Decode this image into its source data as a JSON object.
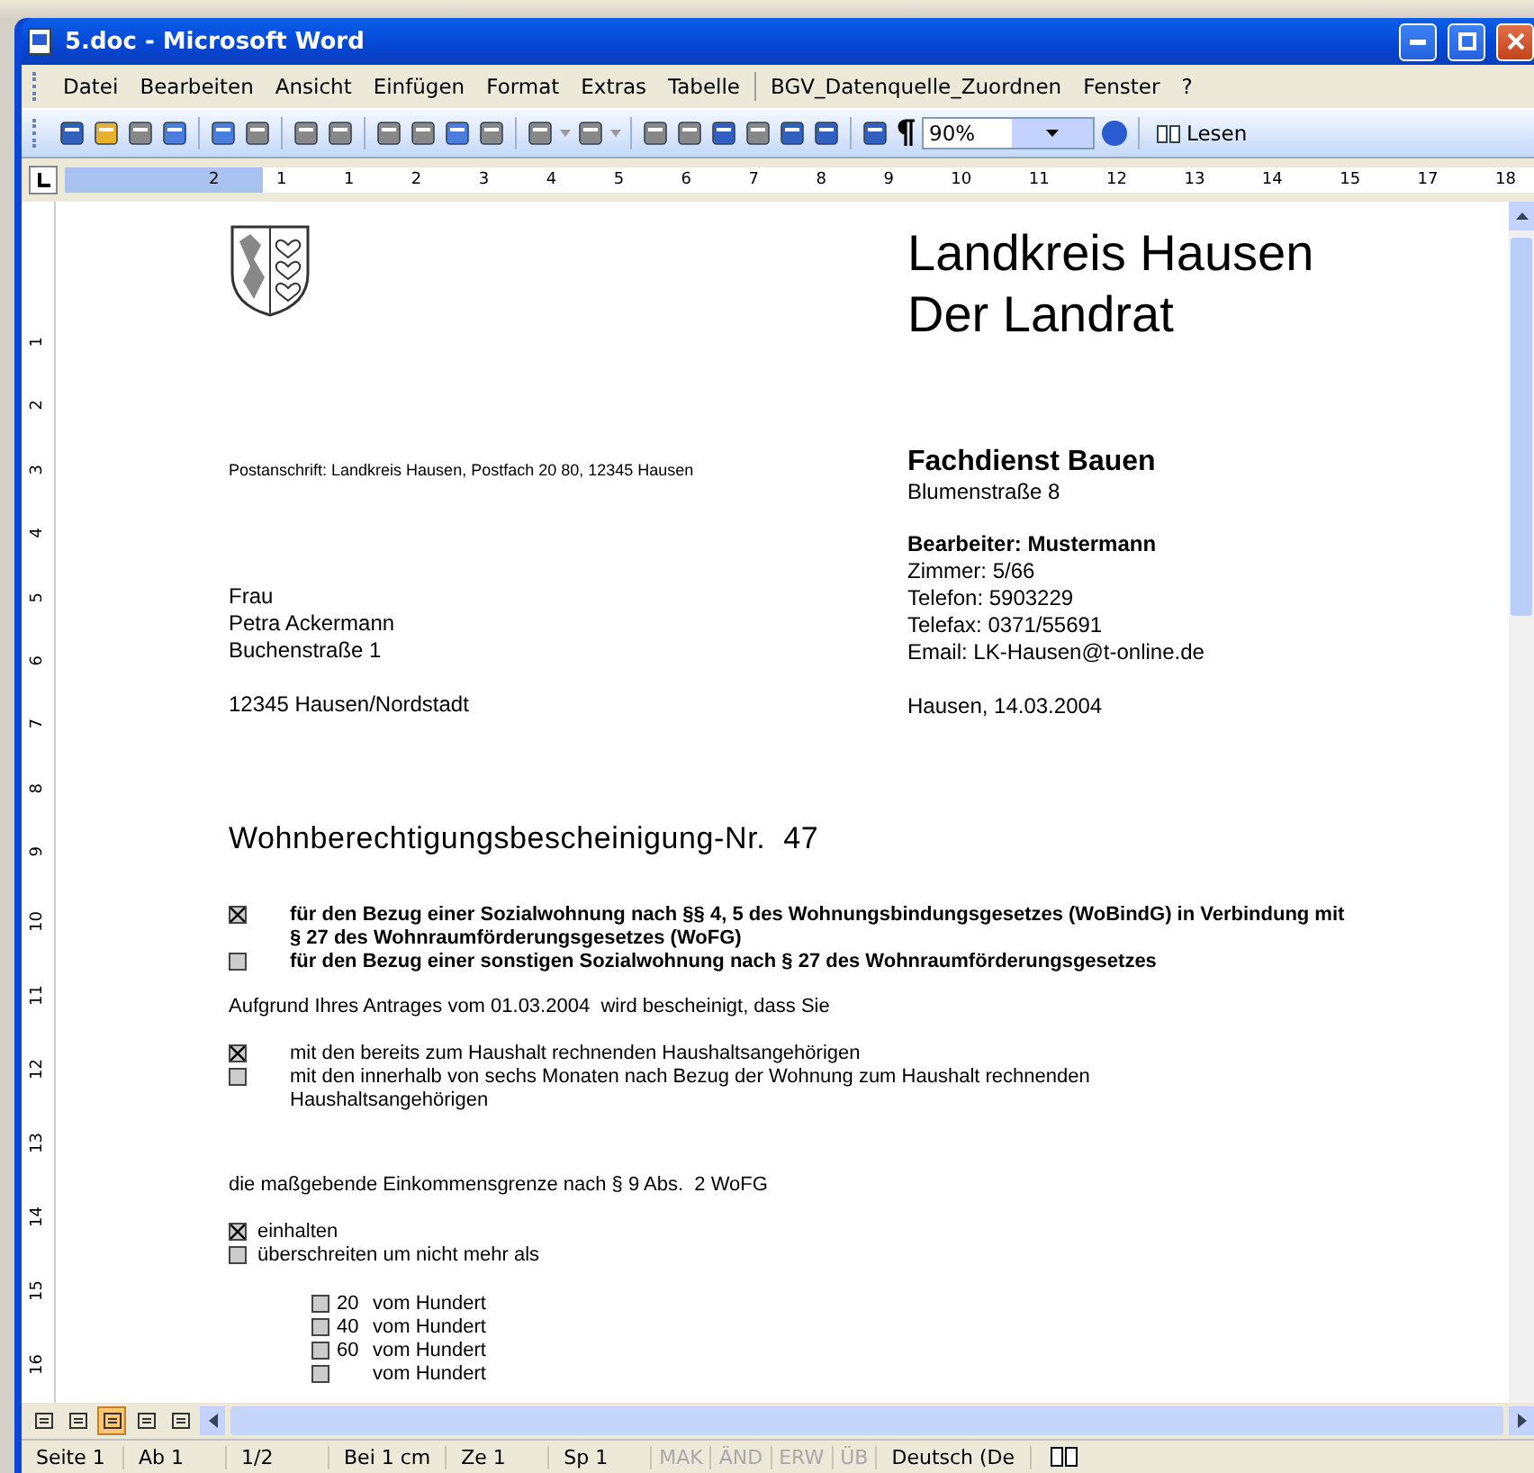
{
  "window": {
    "title": "5.doc - Microsoft Word"
  },
  "menu": [
    "Datei",
    "Bearbeiten",
    "Ansicht",
    "Einfügen",
    "Format",
    "Extras",
    "Tabelle",
    "BGV_Datenquelle_Zuordnen",
    "Fenster",
    "?"
  ],
  "toolbar": {
    "zoom": "90%",
    "read_button": "Lesen"
  },
  "ruler": {
    "marks": [
      "2",
      "1",
      "1",
      "2",
      "3",
      "4",
      "5",
      "6",
      "7",
      "8",
      "9",
      "10",
      "11",
      "12",
      "13",
      "14",
      "15",
      "17",
      "18"
    ]
  },
  "vertical_ruler": {
    "marks": [
      "1",
      "2",
      "3",
      "4",
      "5",
      "6",
      "7",
      "8",
      "9",
      "10",
      "11",
      "12",
      "13",
      "14",
      "15",
      "16"
    ]
  },
  "letter": {
    "org_lines": [
      "Landkreis Hausen",
      "Der Landrat"
    ],
    "return_address": "Postanschrift: Landkreis Hausen, Postfach 20 80, 12345 Hausen",
    "recipient": [
      "Frau",
      "Petra Ackermann",
      "Buchenstraße 1"
    ],
    "recipient_city": "12345 Hausen/Nordstadt",
    "department": "Fachdienst Bauen",
    "department_address": "Blumenstraße 8",
    "clerk": "Bearbeiter: Mustermann",
    "contact": [
      "Zimmer: 5/66",
      "Telefon: 5903229",
      "Telefax: 0371/55691",
      "Email: LK-Hausen@t-online.de"
    ],
    "date": "Hausen, 14.03.2004",
    "certificate_title": "Wohnberechtigungsbescheinigung-Nr.  47",
    "purpose_options": [
      {
        "text": "für den Bezug einer Sozialwohnung nach §§ 4, 5 des Wohnungsbindungsgesetzes (WoBindG) in Verbindung mit § 27 des Wohnraumförderungsgesetzes (WoFG)",
        "checked": true
      },
      {
        "text": "für den Bezug einer sonstigen Sozialwohnung nach § 27 des Wohnraumförderungsgesetzes",
        "checked": false
      }
    ],
    "application_text": "Aufgrund Ihres Antrages vom 01.03.2004  wird bescheinigt, dass Sie",
    "household_options": [
      {
        "text": "mit den bereits zum Haushalt rechnenden Haushaltsangehörigen",
        "checked": true
      },
      {
        "text": "mit den innerhalb von sechs Monaten nach Bezug der Wohnung zum Haushalt rechnenden Haushaltsangehörigen",
        "checked": false
      }
    ],
    "income_text": "die maßgebende Einkommensgrenze nach § 9 Abs.  2 WoFG",
    "income_options": [
      {
        "text": "einhalten",
        "checked": true
      },
      {
        "text": "überschreiten um nicht mehr als",
        "checked": false
      }
    ],
    "percent_options": [
      {
        "value": "20",
        "text": "vom Hundert",
        "checked": false
      },
      {
        "value": "40",
        "text": "vom Hundert",
        "checked": false
      },
      {
        "value": "60",
        "text": "vom Hundert",
        "checked": false
      },
      {
        "text": "vom Hundert",
        "checked": false
      }
    ]
  },
  "status_bar": {
    "fields": [
      "Seite 1",
      "Ab 1",
      "1/2",
      "Bei 1 cm",
      "Ze 1",
      "Sp 1"
    ],
    "indicators": [
      {
        "label": "MAK",
        "active": false
      },
      {
        "label": "ÄND",
        "active": false
      },
      {
        "label": "ERW",
        "active": false
      },
      {
        "label": "ÜB",
        "active": false
      }
    ],
    "language": "Deutsch (De"
  }
}
